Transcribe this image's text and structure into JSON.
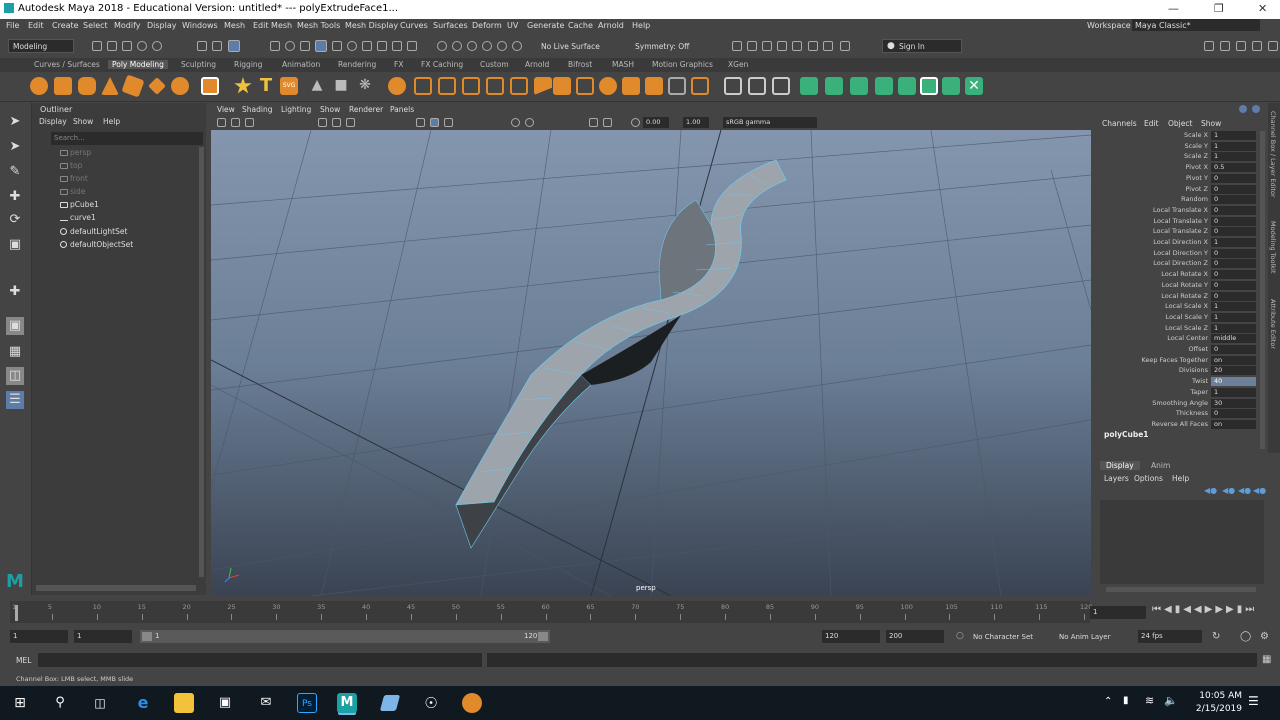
{
  "window": {
    "title": "Autodesk Maya 2018 - Educational Version: untitled*   ---   polyExtrudeFace1..."
  },
  "menubar": [
    "File",
    "Edit",
    "Create",
    "Select",
    "Modify",
    "Display",
    "Windows",
    "Mesh",
    "Edit Mesh",
    "Mesh Tools",
    "Mesh Display",
    "Curves",
    "Surfaces",
    "Deform",
    "UV",
    "Generate",
    "Cache",
    "Arnold",
    "Help"
  ],
  "workspace": {
    "label": "Workspace :",
    "value": "Maya Classic*"
  },
  "toolbar": {
    "mode": "Modeling",
    "live_surface": "No Live Surface",
    "symmetry": "Symmetry: Off",
    "sign_in": "Sign In"
  },
  "shelf_tabs": [
    "Curves / Surfaces",
    "Poly Modeling",
    "Sculpting",
    "Rigging",
    "Animation",
    "Rendering",
    "FX",
    "FX Caching",
    "Custom",
    "Arnold",
    "Bifrost",
    "MASH",
    "Motion Graphics",
    "XGen"
  ],
  "shelf_active": "Poly Modeling",
  "outliner": {
    "title": "Outliner",
    "menu": [
      "Display",
      "Show",
      "Help"
    ],
    "search_placeholder": "Search...",
    "items": [
      {
        "label": "persp",
        "dim": true
      },
      {
        "label": "top",
        "dim": true
      },
      {
        "label": "front",
        "dim": true
      },
      {
        "label": "side",
        "dim": true
      },
      {
        "label": "pCube1",
        "dim": false
      },
      {
        "label": "curve1",
        "dim": false
      },
      {
        "label": "defaultLightSet",
        "dim": false
      },
      {
        "label": "defaultObjectSet",
        "dim": false
      }
    ]
  },
  "viewport": {
    "menu": [
      "View",
      "Shading",
      "Lighting",
      "Show",
      "Renderer",
      "Panels"
    ],
    "exposure": "0.00",
    "gamma": "1.00",
    "color_space": "sRGB gamma",
    "camera": "persp"
  },
  "channel_box": {
    "menu": [
      "Channels",
      "Edit",
      "Object",
      "Show"
    ],
    "channels": [
      {
        "label": "Scale X",
        "value": "1"
      },
      {
        "label": "Scale Y",
        "value": "1"
      },
      {
        "label": "Scale Z",
        "value": "1"
      },
      {
        "label": "Pivot X",
        "value": "0.5"
      },
      {
        "label": "Pivot Y",
        "value": "0"
      },
      {
        "label": "Pivot Z",
        "value": "0"
      },
      {
        "label": "Random",
        "value": "0"
      },
      {
        "label": "Local Translate X",
        "value": "0"
      },
      {
        "label": "Local Translate Y",
        "value": "0"
      },
      {
        "label": "Local Translate Z",
        "value": "0"
      },
      {
        "label": "Local Direction X",
        "value": "1"
      },
      {
        "label": "Local Direction Y",
        "value": "0"
      },
      {
        "label": "Local Direction Z",
        "value": "0"
      },
      {
        "label": "Local Rotate X",
        "value": "0"
      },
      {
        "label": "Local Rotate Y",
        "value": "0"
      },
      {
        "label": "Local Rotate Z",
        "value": "0"
      },
      {
        "label": "Local Scale X",
        "value": "1"
      },
      {
        "label": "Local Scale Y",
        "value": "1"
      },
      {
        "label": "Local Scale Z",
        "value": "1"
      },
      {
        "label": "Local Center",
        "value": "middle"
      },
      {
        "label": "Offset",
        "value": "0"
      },
      {
        "label": "Keep Faces Together",
        "value": "on"
      },
      {
        "label": "Divisions",
        "value": "20"
      },
      {
        "label": "Twist",
        "value": "40"
      },
      {
        "label": "Taper",
        "value": "1"
      },
      {
        "label": "Smoothing Angle",
        "value": "30"
      },
      {
        "label": "Thickness",
        "value": "0"
      },
      {
        "label": "Reverse All Faces",
        "value": "on"
      }
    ],
    "node": "polyCube1",
    "side_tabs": [
      "Channel Box / Layer Editor",
      "Modeling Toolkit",
      "Attribute Editor"
    ]
  },
  "layer_editor": {
    "tabs": [
      "Display",
      "Anim"
    ],
    "menu": [
      "Layers",
      "Options",
      "Help"
    ]
  },
  "timeline": {
    "ticks": [
      "1",
      "5",
      "10",
      "15",
      "20",
      "25",
      "30",
      "35",
      "40",
      "45",
      "50",
      "55",
      "60",
      "65",
      "70",
      "75",
      "80",
      "85",
      "90",
      "95",
      "100",
      "105",
      "110",
      "115",
      "120"
    ],
    "current_frame": "1"
  },
  "range": {
    "start": "1",
    "playback_start": "1",
    "slider_start": "1",
    "slider_end": "120",
    "playback_end": "120",
    "end": "200",
    "character_set": "No Character Set",
    "anim_layer": "No Anim Layer",
    "fps": "24 fps"
  },
  "command_line": {
    "label": "MEL"
  },
  "help_line": "Channel Box: LMB select, MMB slide",
  "taskbar": {
    "time": "10:05 AM",
    "date": "2/15/2019"
  }
}
